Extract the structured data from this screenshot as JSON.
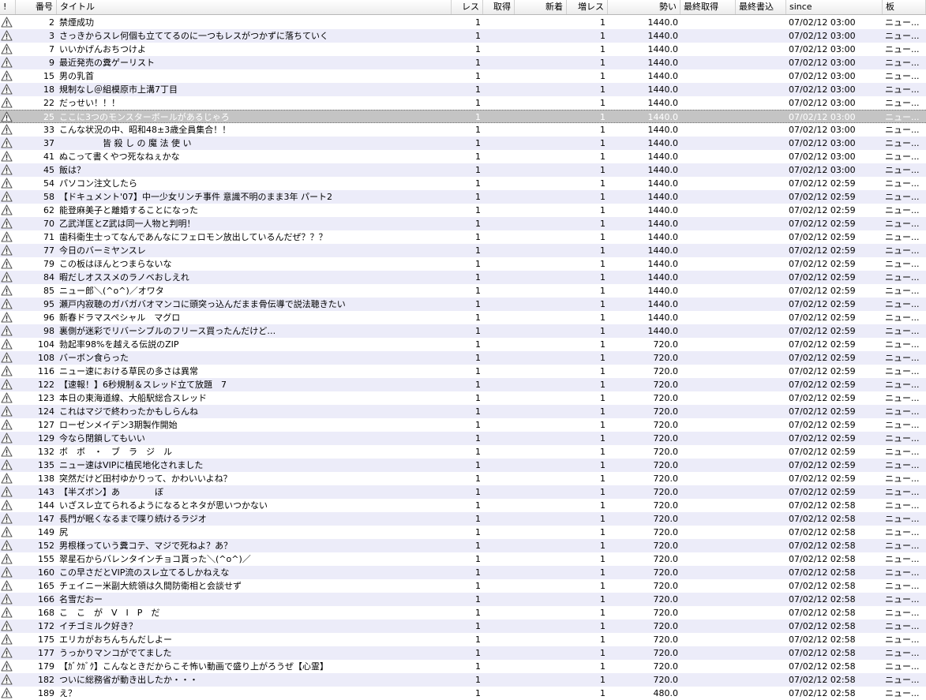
{
  "columns": [
    {
      "key": "icon",
      "label": "!",
      "align": "l"
    },
    {
      "key": "no",
      "label": "番号",
      "align": "r"
    },
    {
      "key": "title",
      "label": "タイトル",
      "align": "l"
    },
    {
      "key": "res",
      "label": "レス",
      "align": "r"
    },
    {
      "key": "got",
      "label": "取得",
      "align": "r"
    },
    {
      "key": "new",
      "label": "新着",
      "align": "r"
    },
    {
      "key": "inc",
      "label": "増レス",
      "align": "r"
    },
    {
      "key": "momentum",
      "label": "勢い",
      "align": "r"
    },
    {
      "key": "lastget",
      "label": "最終取得",
      "align": "l"
    },
    {
      "key": "lastwrite",
      "label": "最終書込",
      "align": "l"
    },
    {
      "key": "since",
      "label": "since",
      "align": "l"
    },
    {
      "key": "board",
      "label": "板",
      "align": "l"
    }
  ],
  "icon_name": "warning-icon",
  "selected_index": 7,
  "colors": {
    "row_alt": "#ececf9",
    "selected": "#c4c4c4"
  },
  "rows": [
    {
      "no": "2",
      "title": "禁煙成功",
      "res": "1",
      "inc": "1",
      "momentum": "1440.0",
      "since": "07/02/12 03:00",
      "board": "ニュー..."
    },
    {
      "no": "3",
      "title": "さっきからスレ何個も立ててるのに一つもレスがつかずに落ちていく",
      "res": "1",
      "inc": "1",
      "momentum": "1440.0",
      "since": "07/02/12 03:00",
      "board": "ニュー..."
    },
    {
      "no": "7",
      "title": "いいかげんおちつけよ",
      "res": "1",
      "inc": "1",
      "momentum": "1440.0",
      "since": "07/02/12 03:00",
      "board": "ニュー..."
    },
    {
      "no": "9",
      "title": "最近発売の糞ゲーリスト",
      "res": "1",
      "inc": "1",
      "momentum": "1440.0",
      "since": "07/02/12 03:00",
      "board": "ニュー..."
    },
    {
      "no": "15",
      "title": "男の乳首",
      "res": "1",
      "inc": "1",
      "momentum": "1440.0",
      "since": "07/02/12 03:00",
      "board": "ニュー..."
    },
    {
      "no": "18",
      "title": "規制なし＠組模原市上溝7丁目",
      "res": "1",
      "inc": "1",
      "momentum": "1440.0",
      "since": "07/02/12 03:00",
      "board": "ニュー..."
    },
    {
      "no": "22",
      "title": "だっせい！！！",
      "res": "1",
      "inc": "1",
      "momentum": "1440.0",
      "since": "07/02/12 03:00",
      "board": "ニュー..."
    },
    {
      "no": "25",
      "title": "ここに3つのモンスターボールがあるじゃろ",
      "res": "1",
      "inc": "1",
      "momentum": "1440.0",
      "since": "07/02/12 03:00",
      "board": "ニュー..."
    },
    {
      "no": "33",
      "title": "こんな状況の中、昭和48±3歳全員集合！！",
      "res": "1",
      "inc": "1",
      "momentum": "1440.0",
      "since": "07/02/12 03:00",
      "board": "ニュー..."
    },
    {
      "no": "37",
      "title": "　　　　　皆 殺 し の 魔 法 使 い",
      "res": "1",
      "inc": "1",
      "momentum": "1440.0",
      "since": "07/02/12 03:00",
      "board": "ニュー..."
    },
    {
      "no": "41",
      "title": "ぬこって書くやつ死なねぇかな",
      "res": "1",
      "inc": "1",
      "momentum": "1440.0",
      "since": "07/02/12 03:00",
      "board": "ニュー..."
    },
    {
      "no": "45",
      "title": "飯は？",
      "res": "1",
      "inc": "1",
      "momentum": "1440.0",
      "since": "07/02/12 03:00",
      "board": "ニュー..."
    },
    {
      "no": "54",
      "title": "パソコン注文したら",
      "res": "1",
      "inc": "1",
      "momentum": "1440.0",
      "since": "07/02/12 02:59",
      "board": "ニュー..."
    },
    {
      "no": "58",
      "title": "【ドキュメント'07】中一少女リンチ事件 意識不明のまま3年 パート2",
      "res": "1",
      "inc": "1",
      "momentum": "1440.0",
      "since": "07/02/12 02:59",
      "board": "ニュー..."
    },
    {
      "no": "62",
      "title": "能登麻美子と離婚することになった",
      "res": "1",
      "inc": "1",
      "momentum": "1440.0",
      "since": "07/02/12 02:59",
      "board": "ニュー..."
    },
    {
      "no": "70",
      "title": "乙武洋匡とZ武は同一人物と判明！",
      "res": "1",
      "inc": "1",
      "momentum": "1440.0",
      "since": "07/02/12 02:59",
      "board": "ニュー..."
    },
    {
      "no": "71",
      "title": "歯科衛生士ってなんであんなにフェロモン放出しているんだぜ？？？",
      "res": "1",
      "inc": "1",
      "momentum": "1440.0",
      "since": "07/02/12 02:59",
      "board": "ニュー..."
    },
    {
      "no": "77",
      "title": "今日のバーミヤンスレ",
      "res": "1",
      "inc": "1",
      "momentum": "1440.0",
      "since": "07/02/12 02:59",
      "board": "ニュー..."
    },
    {
      "no": "79",
      "title": "この板はほんとつまらないな",
      "res": "1",
      "inc": "1",
      "momentum": "1440.0",
      "since": "07/02/12 02:59",
      "board": "ニュー..."
    },
    {
      "no": "84",
      "title": "暇だしオススメのラノベおしえれ",
      "res": "1",
      "inc": "1",
      "momentum": "1440.0",
      "since": "07/02/12 02:59",
      "board": "ニュー..."
    },
    {
      "no": "85",
      "title": "ニュー郎＼(^o^)／オワタ",
      "res": "1",
      "inc": "1",
      "momentum": "1440.0",
      "since": "07/02/12 02:59",
      "board": "ニュー..."
    },
    {
      "no": "95",
      "title": "瀬戸内寂聴のガバガバオマンコに頭突っ込んだまま骨伝導で説法聴きたい",
      "res": "1",
      "inc": "1",
      "momentum": "1440.0",
      "since": "07/02/12 02:59",
      "board": "ニュー..."
    },
    {
      "no": "96",
      "title": "新春ドラマスペシャル　マグロ",
      "res": "1",
      "inc": "1",
      "momentum": "1440.0",
      "since": "07/02/12 02:59",
      "board": "ニュー..."
    },
    {
      "no": "98",
      "title": "裏側が迷彩でリバーシブルのフリース買ったんだけど…",
      "res": "1",
      "inc": "1",
      "momentum": "1440.0",
      "since": "07/02/12 02:59",
      "board": "ニュー..."
    },
    {
      "no": "104",
      "title": "勃起率98%を越える伝説のZIP",
      "res": "1",
      "inc": "1",
      "momentum": "720.0",
      "since": "07/02/12 02:59",
      "board": "ニュー..."
    },
    {
      "no": "108",
      "title": "バーボン食らった",
      "res": "1",
      "inc": "1",
      "momentum": "720.0",
      "since": "07/02/12 02:59",
      "board": "ニュー..."
    },
    {
      "no": "116",
      "title": "ニュー速における草民の多さは異常",
      "res": "1",
      "inc": "1",
      "momentum": "720.0",
      "since": "07/02/12 02:59",
      "board": "ニュー..."
    },
    {
      "no": "122",
      "title": "【速報！】6秒規制＆スレッド立て放題　7",
      "res": "1",
      "inc": "1",
      "momentum": "720.0",
      "since": "07/02/12 02:59",
      "board": "ニュー..."
    },
    {
      "no": "123",
      "title": "本日の東海道線、大船駅総合スレッド",
      "res": "1",
      "inc": "1",
      "momentum": "720.0",
      "since": "07/02/12 02:59",
      "board": "ニュー..."
    },
    {
      "no": "124",
      "title": "これはマジで終わったかもしらんね",
      "res": "1",
      "inc": "1",
      "momentum": "720.0",
      "since": "07/02/12 02:59",
      "board": "ニュー..."
    },
    {
      "no": "127",
      "title": "ローゼンメイデン3期製作開始",
      "res": "1",
      "inc": "1",
      "momentum": "720.0",
      "since": "07/02/12 02:59",
      "board": "ニュー..."
    },
    {
      "no": "129",
      "title": "今なら閉鎖してもいい",
      "res": "1",
      "inc": "1",
      "momentum": "720.0",
      "since": "07/02/12 02:59",
      "board": "ニュー..."
    },
    {
      "no": "132",
      "title": "ボ　ボ　・　ブ　ラ　ジ　ル",
      "res": "1",
      "inc": "1",
      "momentum": "720.0",
      "since": "07/02/12 02:59",
      "board": "ニュー..."
    },
    {
      "no": "135",
      "title": "ニュー速はVIPに植民地化されました",
      "res": "1",
      "inc": "1",
      "momentum": "720.0",
      "since": "07/02/12 02:59",
      "board": "ニュー..."
    },
    {
      "no": "138",
      "title": "突然だけど田村ゆかりって、かわいいよね？",
      "res": "1",
      "inc": "1",
      "momentum": "720.0",
      "since": "07/02/12 02:59",
      "board": "ニュー..."
    },
    {
      "no": "143",
      "title": "【半ズボン】あ　　　　ぼ",
      "res": "1",
      "inc": "1",
      "momentum": "720.0",
      "since": "07/02/12 02:59",
      "board": "ニュー..."
    },
    {
      "no": "144",
      "title": "いざスレ立てられるようになるとネタが思いつかない",
      "res": "1",
      "inc": "1",
      "momentum": "720.0",
      "since": "07/02/12 02:58",
      "board": "ニュー..."
    },
    {
      "no": "147",
      "title": "長門が眠くなるまで喋り続けるラジオ",
      "res": "1",
      "inc": "1",
      "momentum": "720.0",
      "since": "07/02/12 02:58",
      "board": "ニュー..."
    },
    {
      "no": "149",
      "title": "尻",
      "res": "1",
      "inc": "1",
      "momentum": "720.0",
      "since": "07/02/12 02:58",
      "board": "ニュー..."
    },
    {
      "no": "152",
      "title": "男根様っていう糞コテ、マジで死ねよ？あ？",
      "res": "1",
      "inc": "1",
      "momentum": "720.0",
      "since": "07/02/12 02:58",
      "board": "ニュー..."
    },
    {
      "no": "155",
      "title": "翠星石からバレンタインチョコ貰った＼(^o^)／",
      "res": "1",
      "inc": "1",
      "momentum": "720.0",
      "since": "07/02/12 02:58",
      "board": "ニュー..."
    },
    {
      "no": "160",
      "title": "この早さだとVIP流のスレ立てるしかねえな",
      "res": "1",
      "inc": "1",
      "momentum": "720.0",
      "since": "07/02/12 02:58",
      "board": "ニュー..."
    },
    {
      "no": "165",
      "title": "チェイニー米副大統領は久間防衛相と会談せず",
      "res": "1",
      "inc": "1",
      "momentum": "720.0",
      "since": "07/02/12 02:58",
      "board": "ニュー..."
    },
    {
      "no": "166",
      "title": "名雪だおー",
      "res": "1",
      "inc": "1",
      "momentum": "720.0",
      "since": "07/02/12 02:58",
      "board": "ニュー..."
    },
    {
      "no": "168",
      "title": "こ　こ　が　V　I　P　だ",
      "res": "1",
      "inc": "1",
      "momentum": "720.0",
      "since": "07/02/12 02:58",
      "board": "ニュー..."
    },
    {
      "no": "172",
      "title": "イチゴミルク好き？",
      "res": "1",
      "inc": "1",
      "momentum": "720.0",
      "since": "07/02/12 02:58",
      "board": "ニュー..."
    },
    {
      "no": "175",
      "title": "エリカがおちんちんだしよー",
      "res": "1",
      "inc": "1",
      "momentum": "720.0",
      "since": "07/02/12 02:58",
      "board": "ニュー..."
    },
    {
      "no": "177",
      "title": "うっかりマンコがでてました",
      "res": "1",
      "inc": "1",
      "momentum": "720.0",
      "since": "07/02/12 02:58",
      "board": "ニュー..."
    },
    {
      "no": "179",
      "title": "【ｶﾞｸｶﾞｸ】こんなときだからこそ怖い動画で盛り上がろうぜ【心霊】",
      "res": "1",
      "inc": "1",
      "momentum": "720.0",
      "since": "07/02/12 02:58",
      "board": "ニュー..."
    },
    {
      "no": "182",
      "title": "ついに総務省が動き出したか・・・",
      "res": "1",
      "inc": "1",
      "momentum": "720.0",
      "since": "07/02/12 02:58",
      "board": "ニュー..."
    },
    {
      "no": "189",
      "title": "え？",
      "res": "1",
      "inc": "1",
      "momentum": "480.0",
      "since": "07/02/12 02:58",
      "board": "ニュー..."
    }
  ]
}
